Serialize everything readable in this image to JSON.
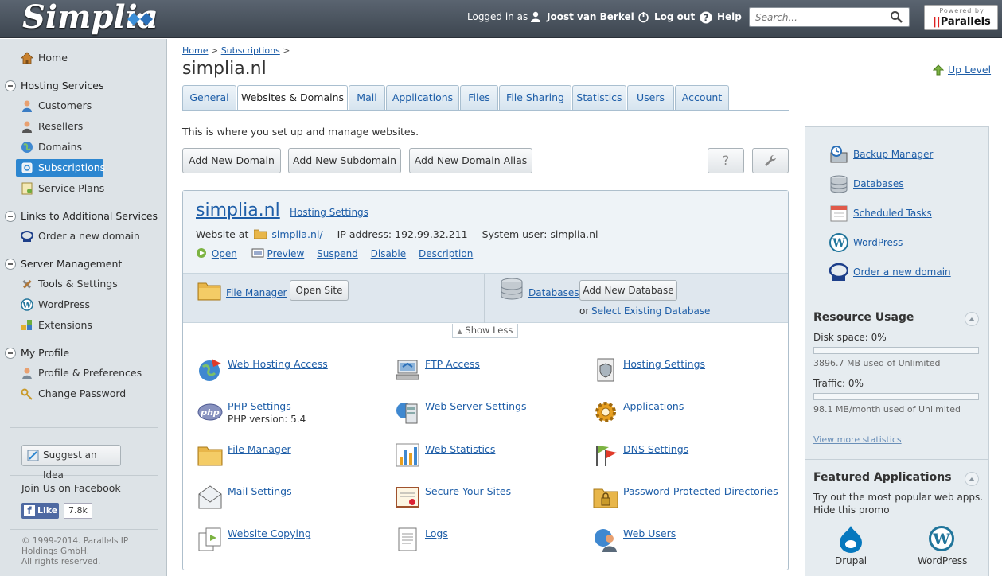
{
  "header": {
    "logo": "Simplia",
    "logged_in_as": "Logged in as",
    "user": "Joost van Berkel",
    "logout": "Log out",
    "help": "Help",
    "search_placeholder": "Search...",
    "powered_by": "Powered by",
    "powered_brand": "Parallels"
  },
  "sidebar": {
    "home": "Home",
    "hosting_services": "Hosting Services",
    "customers": "Customers",
    "resellers": "Resellers",
    "domains": "Domains",
    "subscriptions": "Subscriptions",
    "service_plans": "Service Plans",
    "links_additional": "Links to Additional Services",
    "order_domain": "Order a new domain",
    "server_management": "Server Management",
    "tools_settings": "Tools & Settings",
    "wordpress": "WordPress",
    "extensions": "Extensions",
    "my_profile": "My Profile",
    "profile_prefs": "Profile & Preferences",
    "change_password": "Change Password",
    "suggest_idea": "Suggest an Idea",
    "join_facebook": "Join Us on Facebook",
    "like": "Like",
    "like_count": "7.8k",
    "copyright": "© 1999-2014. Parallels IP Holdings GmbH.",
    "rights": "All rights reserved."
  },
  "breadcrumb": {
    "home": "Home",
    "subscriptions": "Subscriptions",
    "sep": ">"
  },
  "page_title": "simplia.nl",
  "up_level": "Up Level",
  "tabs": [
    "General",
    "Websites & Domains",
    "Mail",
    "Applications",
    "Files",
    "File Sharing",
    "Statistics",
    "Users",
    "Account"
  ],
  "intro": "This is where you set up and manage websites.",
  "buttons": {
    "add_domain": "Add New Domain",
    "add_subdomain": "Add New Subdomain",
    "add_alias": "Add New Domain Alias",
    "help_q": "?"
  },
  "domain": {
    "name": "simplia.nl",
    "hosting_settings": "Hosting Settings",
    "website_at": "Website at",
    "site_link": "simplia.nl/",
    "ip_label": "IP address:",
    "ip": "192.99.32.211",
    "user_label": "System user:",
    "user": "simplia.nl",
    "actions": [
      "Open",
      "Preview",
      "Suspend",
      "Disable",
      "Description"
    ],
    "file_manager": "File Manager",
    "open_site": "Open Site",
    "databases": "Databases",
    "add_db": "Add New Database",
    "or": "or",
    "select_db": "Select Existing Database",
    "show_less": "Show Less"
  },
  "features": {
    "web_hosting_access": "Web Hosting Access",
    "ftp_access": "FTP Access",
    "hosting_settings": "Hosting Settings",
    "php_settings": "PHP Settings",
    "php_version": "PHP version: 5.4",
    "web_server_settings": "Web Server Settings",
    "applications": "Applications",
    "file_manager": "File Manager",
    "web_statistics": "Web Statistics",
    "dns_settings": "DNS Settings",
    "mail_settings": "Mail Settings",
    "secure_sites": "Secure Your Sites",
    "password_dirs": "Password-Protected Directories",
    "website_copying": "Website Copying",
    "logs": "Logs",
    "web_users": "Web Users"
  },
  "right_panel": {
    "links": [
      "Backup Manager",
      "Databases",
      "Scheduled Tasks",
      "WordPress",
      "Order a new domain"
    ],
    "resource_usage": "Resource Usage",
    "disk_space": "Disk space: 0%",
    "disk_fill": 0,
    "disk_detail": "3896.7 MB used of Unlimited",
    "traffic": "Traffic: 0%",
    "traffic_fill": 0,
    "traffic_detail": "98.1 MB/month used of Unlimited",
    "view_more": "View more statistics",
    "featured_apps": "Featured Applications",
    "featured_desc": "Try out the most popular web apps.",
    "hide_promo": "Hide this promo",
    "apps": [
      "Drupal",
      "WordPress"
    ]
  }
}
